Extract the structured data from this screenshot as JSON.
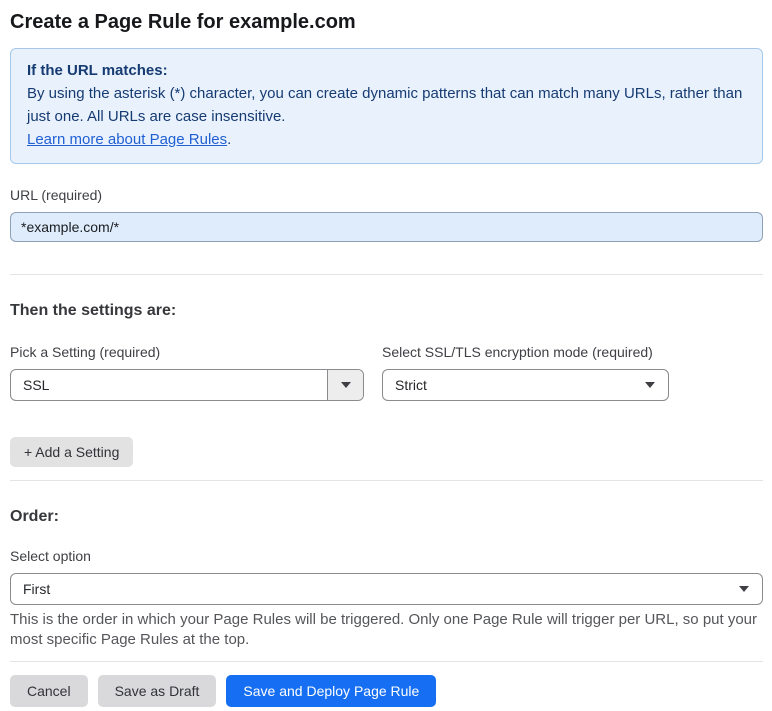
{
  "page": {
    "title": "Create a Page Rule for example.com"
  },
  "info_box": {
    "heading": "If the URL matches:",
    "body": "By using the asterisk (*) character, you can create dynamic patterns that can match many URLs, rather than just one. All URLs are case insensitive.",
    "link_label": "Learn more about Page Rules",
    "link_suffix": "."
  },
  "url_field": {
    "label": "URL (required)",
    "value": "*example.com/*"
  },
  "settings": {
    "heading": "Then the settings are:",
    "pick_setting": {
      "label": "Pick a Setting (required)",
      "value": "SSL"
    },
    "encryption_mode": {
      "label": "Select SSL/TLS encryption mode (required)",
      "value": "Strict"
    },
    "add_button_label": "+ Add a Setting"
  },
  "order": {
    "heading": "Order:",
    "select_label": "Select option",
    "value": "First",
    "helper": "This is the order in which your Page Rules will be triggered. Only one Page Rule will trigger per URL, so put your most specific Page Rules at the top."
  },
  "footer": {
    "cancel_label": "Cancel",
    "save_draft_label": "Save as Draft",
    "save_deploy_label": "Save and Deploy Page Rule"
  },
  "colors": {
    "accent_blue": "#166ff2",
    "info_bg": "#e9f2fc",
    "info_border": "#a6c8ea",
    "info_text": "#163b73",
    "link_blue": "#2160d3",
    "url_input_bg": "#dfecfb"
  }
}
